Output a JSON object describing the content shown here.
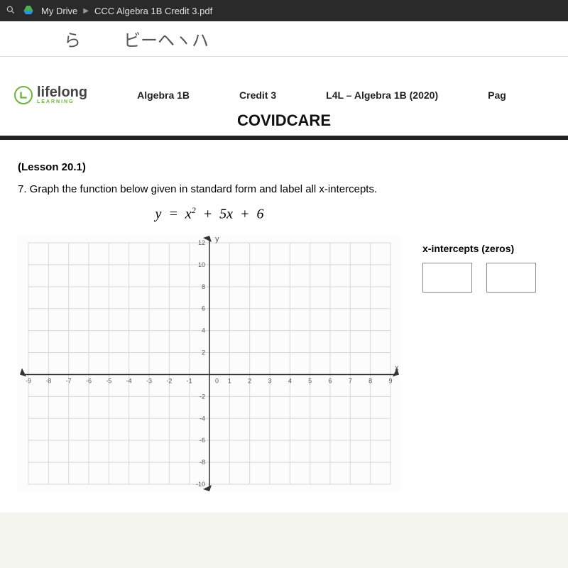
{
  "browser": {
    "drive_label": "My Drive",
    "filename": "CCC Algebra 1B Credit 3.pdf"
  },
  "header": {
    "brand_name": "lifelong",
    "brand_sub": "LEARNING",
    "col1": "Algebra 1B",
    "col2": "Credit 3",
    "col3": "L4L – Algebra 1B (2020)",
    "col4": "Pag",
    "title": "COVIDCARE"
  },
  "content": {
    "lesson": "(Lesson 20.1)",
    "question": "7. Graph the function below given in standard form and label all x-intercepts.",
    "equation_plain": "y = x² + 5x + 6",
    "answers_label": "x-intercepts (zeros)"
  },
  "chart_data": {
    "type": "scatter",
    "title": "",
    "xlabel": "x",
    "ylabel": "y",
    "xlim": [
      -9,
      9
    ],
    "ylim": [
      -10,
      12
    ],
    "x_ticks": [
      -9,
      -8,
      -7,
      -6,
      -5,
      -4,
      -3,
      -2,
      -1,
      0,
      1,
      2,
      3,
      4,
      5,
      6,
      7,
      8,
      9
    ],
    "y_ticks": [
      -10,
      -8,
      -6,
      -4,
      -2,
      0,
      2,
      4,
      6,
      8,
      10,
      12
    ],
    "series": []
  }
}
